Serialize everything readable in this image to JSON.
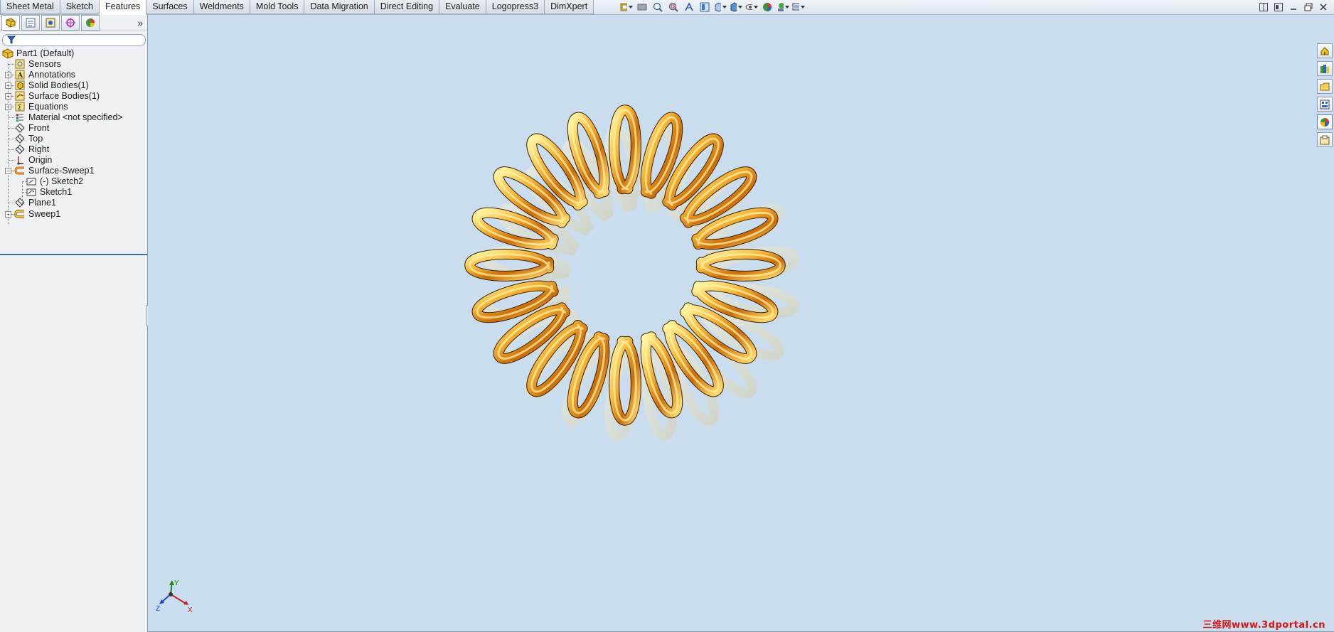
{
  "tabs": [
    {
      "label": "Sheet Metal",
      "active": false
    },
    {
      "label": "Sketch",
      "active": false
    },
    {
      "label": "Features",
      "active": true
    },
    {
      "label": "Surfaces",
      "active": false
    },
    {
      "label": "Weldments",
      "active": false
    },
    {
      "label": "Mold Tools",
      "active": false
    },
    {
      "label": "Data Migration",
      "active": false
    },
    {
      "label": "Direct Editing",
      "active": false
    },
    {
      "label": "Evaluate",
      "active": false
    },
    {
      "label": "Logopress3",
      "active": false
    },
    {
      "label": "DimXpert",
      "active": false
    }
  ],
  "view_toolbar": [
    "view-orientation-icon",
    "previous-view-icon",
    "zoom-to-fit-icon",
    "zoom-to-area-icon",
    "section-view-icon",
    "view-palette-icon",
    "view-orientation-dropdown-icon",
    "display-style-icon",
    "hide-show-items-icon",
    "edit-appearance-icon",
    "apply-scene-icon",
    "view-settings-icon"
  ],
  "feature_tree": {
    "root": "Part1  (Default)",
    "items": [
      {
        "label": "Sensors",
        "icon": "sensor-icon",
        "expandable": false
      },
      {
        "label": "Annotations",
        "icon": "annotations-icon",
        "expandable": true
      },
      {
        "label": "Solid Bodies(1)",
        "icon": "solid-bodies-icon",
        "expandable": true
      },
      {
        "label": "Surface Bodies(1)",
        "icon": "surface-bodies-icon",
        "expandable": true
      },
      {
        "label": "Equations",
        "icon": "equations-icon",
        "expandable": true
      },
      {
        "label": "Material <not specified>",
        "icon": "material-icon",
        "expandable": false
      },
      {
        "label": "Front",
        "icon": "plane-icon",
        "expandable": false
      },
      {
        "label": "Top",
        "icon": "plane-icon",
        "expandable": false
      },
      {
        "label": "Right",
        "icon": "plane-icon",
        "expandable": false
      },
      {
        "label": "Origin",
        "icon": "origin-icon",
        "expandable": false
      },
      {
        "label": "Surface-Sweep1",
        "icon": "surface-sweep-icon",
        "expandable": true,
        "expanded": true
      },
      {
        "label": "(-) Sketch2",
        "icon": "sketch-icon",
        "child": true
      },
      {
        "label": "Sketch1",
        "icon": "sketch-icon",
        "child": true
      },
      {
        "label": "Plane1",
        "icon": "plane-icon",
        "expandable": false
      },
      {
        "label": "Sweep1",
        "icon": "sweep-icon",
        "expandable": true
      }
    ]
  },
  "triad": {
    "x": "X",
    "y": "Y",
    "z": "Z"
  },
  "watermark": "三维网www.3dportal.cn",
  "colors": {
    "viewport_bg": "#c9ddee",
    "spring_gold": "#e8a021",
    "spring_highlight": "#fff3a0",
    "spring_shadow": "#b85d05"
  },
  "model": {
    "type": "toroidal-helix-spring",
    "coil_count": 20
  }
}
